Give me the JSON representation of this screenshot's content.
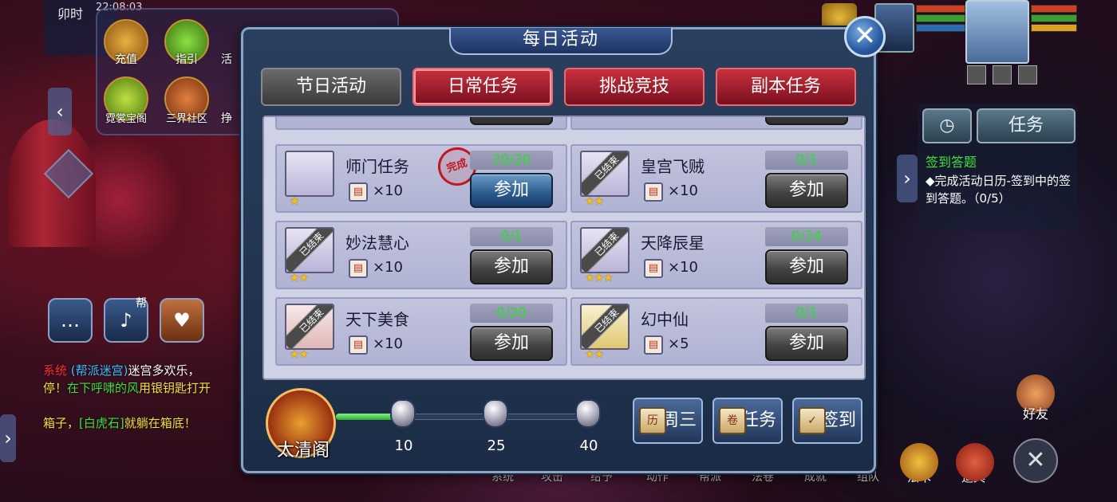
{
  "hud": {
    "time_label": "卯时",
    "clock": "22:08:03",
    "top_menu": [
      {
        "label": "充值",
        "icon": "treasure-chest-icon"
      },
      {
        "label": "指引",
        "icon": "question-scroll-icon"
      },
      {
        "label": "霓裳宝阁",
        "icon": "coin-shop-icon"
      },
      {
        "label": "三界社区",
        "icon": "community-icon"
      }
    ],
    "top_menu_partial": [
      "活",
      "挣"
    ],
    "chat_tab": "帮",
    "chat_lines": [
      {
        "parts": [
          {
            "t": "系统",
            "c": "c-red"
          },
          {
            "t": " (帮派迷宫)",
            "c": "c-blue"
          },
          {
            "t": "迷宫多欢乐，",
            "c": "c-white"
          }
        ]
      },
      {
        "parts": [
          {
            "t": "停！",
            "c": "c-yellow"
          },
          {
            "t": "在下呼啸的风",
            "c": "c-green"
          },
          {
            "t": "用银钥匙打开",
            "c": "c-yellow"
          }
        ]
      },
      {
        "parts": [
          {
            "t": "箱子，",
            "c": "c-yellow"
          },
          {
            "t": "[白虎石]",
            "c": "c-green"
          },
          {
            "t": "就躺在箱底！",
            "c": "c-yellow"
          }
        ]
      }
    ],
    "right_tab": "任务",
    "quest_title": "签到答题",
    "quest_desc": "◆完成活动日历-签到中的签到答题。（0/5）",
    "friends_label": "好友",
    "bottom_bar": [
      "系统",
      "攻击",
      "给予",
      "动作",
      "帮派",
      "法卷",
      "成就",
      "组队",
      "法术",
      "道具"
    ],
    "colors": {
      "accent_red": "#c8303c",
      "green_progress": "#28e028",
      "dialog_bg": "#2a3f5e"
    }
  },
  "dialog": {
    "title": "每日活动",
    "close_icon": "✕",
    "tabs": [
      {
        "label": "节日活动",
        "style": "gray",
        "active": false
      },
      {
        "label": "日常任务",
        "style": "red",
        "active": true
      },
      {
        "label": "挑战竞技",
        "style": "red",
        "active": false
      },
      {
        "label": "副本任务",
        "style": "red",
        "active": false
      }
    ],
    "join_label": "参加",
    "ended_label": "已结束",
    "done_stamp": "完成",
    "activities": [
      {
        "name": "师门任务",
        "stars": 1,
        "reward_qty": "×10",
        "progress": "20/20",
        "ended": false,
        "completed": true,
        "icon": "scroll-icon"
      },
      {
        "name": "皇宫飞贼",
        "stars": 2,
        "reward_qty": "×10",
        "progress": "0/1",
        "ended": true,
        "completed": false,
        "icon": "feather-boot-icon"
      },
      {
        "name": "妙法慧心",
        "stars": 2,
        "reward_qty": "×10",
        "progress": "0/1",
        "ended": true,
        "completed": false,
        "icon": "book-icon"
      },
      {
        "name": "天降辰星",
        "stars": 3,
        "reward_qty": "×10",
        "progress": "0/24",
        "ended": true,
        "completed": false,
        "icon": "stars-icon"
      },
      {
        "name": "天下美食",
        "stars": 2,
        "reward_qty": "×10",
        "progress": "0/20",
        "ended": true,
        "completed": false,
        "icon": "food-icon"
      },
      {
        "name": "幻中仙",
        "stars": 2,
        "reward_qty": "×5",
        "progress": "0/1",
        "ended": true,
        "completed": false,
        "icon": "golden-leaf-icon"
      }
    ],
    "footer": {
      "emblem_name": "太清阁",
      "milestones": [
        "10",
        "25",
        "40"
      ],
      "progress_fraction": 0.25,
      "buttons": [
        {
          "glyph": "历",
          "label": "周三"
        },
        {
          "glyph": "卷",
          "label": "任务"
        },
        {
          "glyph": "✓",
          "label": "签到"
        }
      ]
    }
  }
}
